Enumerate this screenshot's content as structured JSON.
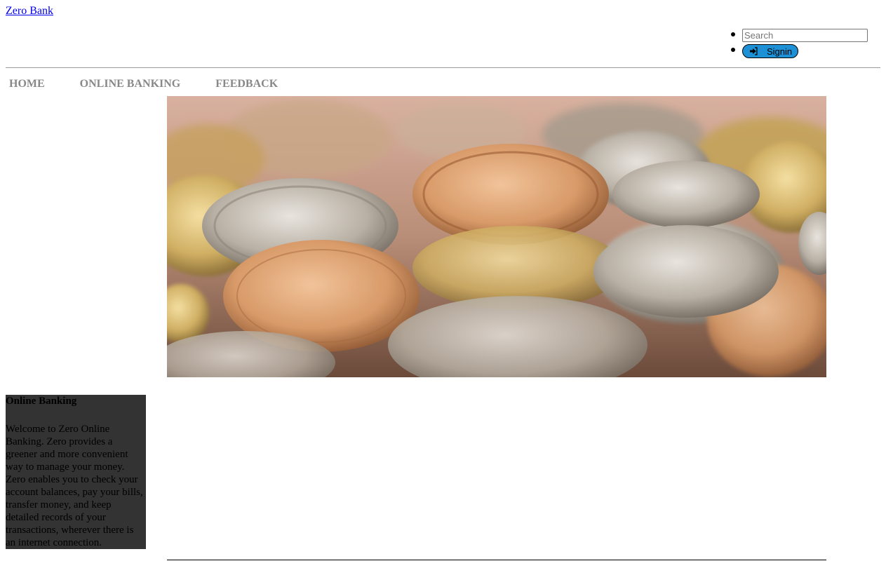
{
  "brand": {
    "label": "Zero Bank"
  },
  "search": {
    "placeholder": "Search",
    "value": ""
  },
  "signin": {
    "label": "Signin",
    "icon": "signin-icon"
  },
  "nav": {
    "items": [
      {
        "label": "HOME"
      },
      {
        "label": "ONLINE BANKING"
      },
      {
        "label": "FEEDBACK"
      }
    ]
  },
  "hero": {
    "subject": "coins-photo"
  },
  "panel": {
    "title": "Online Banking",
    "body": "Welcome to Zero Online Banking. Zero provides a greener and more convenient way to manage your money. Zero enables you to check your account balances, pay your bills, transfer money, and keep detailed records of your transactions, wherever there is an internet connection."
  },
  "colors": {
    "link": "#0000ee",
    "nav_text": "#888888",
    "signin_bg": "#1e90d6",
    "panel_bg": "#333333"
  }
}
